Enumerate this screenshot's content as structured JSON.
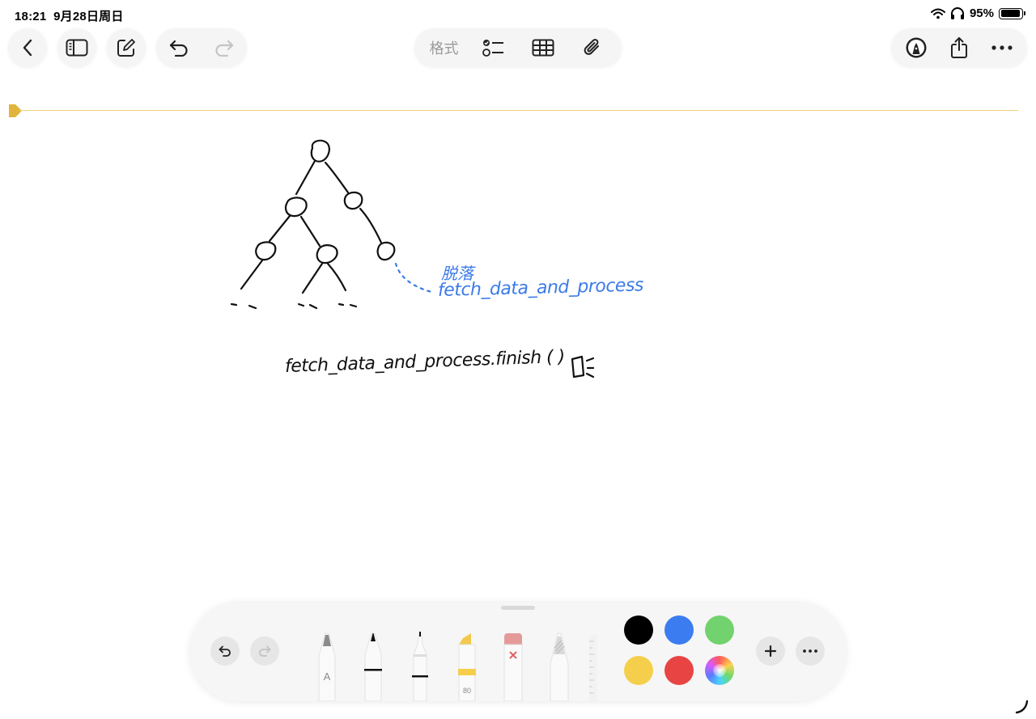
{
  "status": {
    "time": "18:21",
    "date": "9月28日周日",
    "battery": "95%",
    "battery_level": 0.95,
    "icons": [
      "wifi-icon",
      "headphones-icon",
      "battery-icon"
    ]
  },
  "toolbar": {
    "format_label": "格式"
  },
  "note": {
    "blue_title": "脱落",
    "blue_code": "fetch_data_and_process",
    "black_code": "fetch_data_and_process.finish ( )"
  },
  "palette": {
    "marker_number": "80",
    "pen_label": "A",
    "colors": [
      "#000000",
      "#3b7cf0",
      "#72d26e",
      "#f5cf4b",
      "#e84444"
    ]
  },
  "accent": {
    "guide": "#f1d27a",
    "marker": "#e0b53a",
    "ink_blue": "#3b7ae8"
  }
}
